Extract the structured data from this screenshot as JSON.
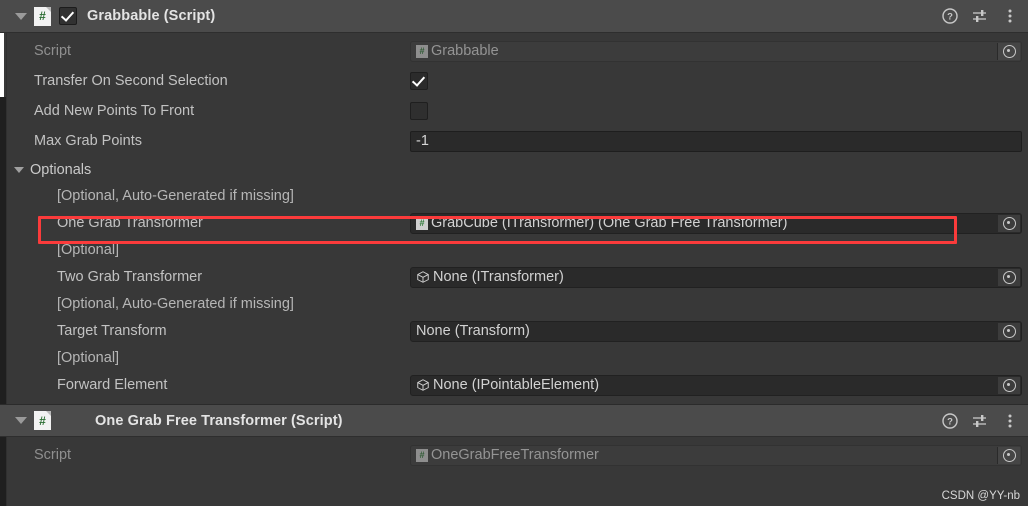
{
  "components": [
    {
      "id": "grabbable",
      "title": "Grabbable (Script)",
      "enabled_checkbox": true,
      "icon": "script-icon",
      "header_icons": [
        "help-icon",
        "preset-icon",
        "more-menu-icon"
      ],
      "rows": [
        {
          "label": "Script",
          "type": "object",
          "value": "Grabbable",
          "value_icon": "script-icon",
          "disabled": true
        },
        {
          "label": "Transfer On Second Selection",
          "type": "checkbox",
          "checked": true
        },
        {
          "label": "Add New Points To Front",
          "type": "checkbox",
          "checked": false
        },
        {
          "label": "Max Grab Points",
          "type": "number",
          "value": "-1"
        }
      ],
      "optionals": {
        "label": "Optionals",
        "expanded": true,
        "entries": [
          {
            "note": "[Optional, Auto-Generated if missing]",
            "label": "One Grab Transformer",
            "value": "GrabCube (ITransformer) (One Grab Free Transformer)",
            "value_icon": "script-icon",
            "highlighted": true
          },
          {
            "note": "[Optional]",
            "label": "Two Grab Transformer",
            "value": "None (ITransformer)",
            "value_icon": "cube-icon",
            "highlighted": false
          },
          {
            "note": "[Optional, Auto-Generated if missing]",
            "label": "Target Transform",
            "value": "None (Transform)",
            "value_icon": "none",
            "highlighted": false
          },
          {
            "note": "[Optional]",
            "label": "Forward Element",
            "value": "None (IPointableElement)",
            "value_icon": "cube-icon",
            "highlighted": false
          }
        ]
      }
    },
    {
      "id": "one-grab-free-transformer",
      "title": "One Grab Free Transformer (Script)",
      "enabled_checkbox": null,
      "icon": "script-icon",
      "header_icons": [
        "help-icon",
        "preset-icon",
        "more-menu-icon"
      ],
      "rows": [
        {
          "label": "Script",
          "type": "object",
          "value": "OneGrabFreeTransformer",
          "value_icon": "script-icon",
          "disabled": true
        }
      ]
    }
  ],
  "watermark": "CSDN @YY-nb",
  "colors": {
    "panel_background": "#383838",
    "header_background": "#4b4b4b",
    "field_background": "#2a2a2a",
    "highlight": "#fb3b3b",
    "text": "#c2c2c2",
    "script_icon_green": "#2b6d32"
  }
}
